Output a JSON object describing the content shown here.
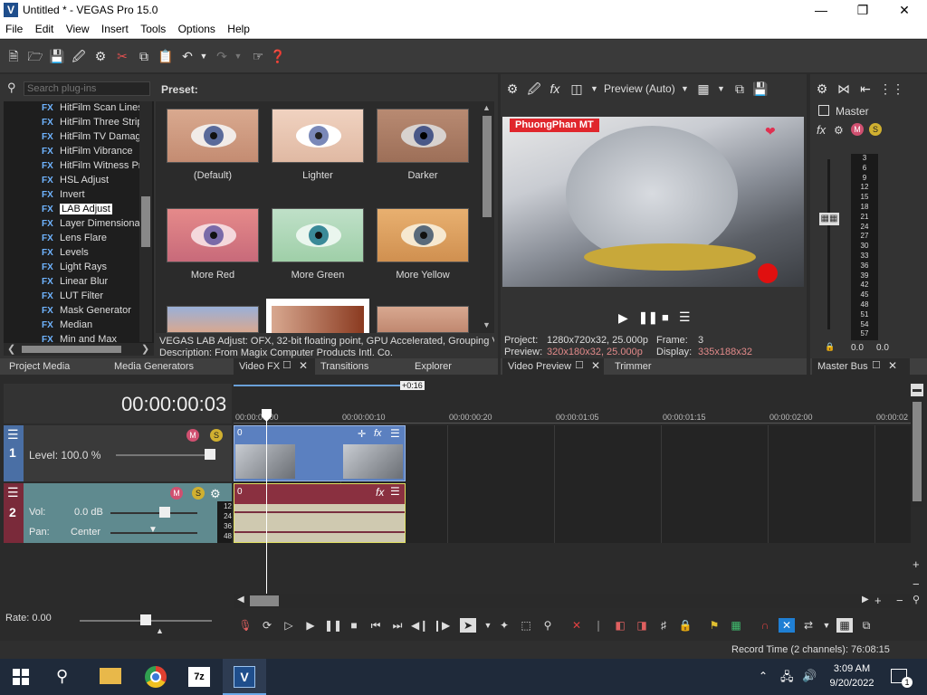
{
  "window": {
    "app_icon": "V",
    "title": "Untitled * - VEGAS Pro 15.0"
  },
  "menu": [
    "File",
    "Edit",
    "View",
    "Insert",
    "Tools",
    "Options",
    "Help"
  ],
  "plugins": {
    "search_placeholder": "Search plug-ins",
    "preset_label": "Preset:",
    "items": [
      "HitFilm Scan Lines",
      "HitFilm Three Strip",
      "HitFilm TV Damage",
      "HitFilm Vibrance",
      "HitFilm Witness Pr",
      "HSL Adjust",
      "Invert",
      "LAB Adjust",
      "Layer Dimensional",
      "Lens Flare",
      "Levels",
      "Light Rays",
      "Linear Blur",
      "LUT Filter",
      "Mask Generator",
      "Median",
      "Min and Max"
    ],
    "selected": "LAB Adjust",
    "presets": [
      "(Default)",
      "Lighter",
      "Darker",
      "More Red",
      "More Green",
      "More Yellow"
    ],
    "info_line1": "VEGAS LAB Adjust: OFX, 32-bit floating point, GPU Accelerated, Grouping VE",
    "info_line2": "Description: From Magix Computer Products Intl. Co."
  },
  "left_tabs": [
    "Project Media",
    "Media Generators",
    "Video FX",
    "Transitions",
    "Explorer"
  ],
  "preview": {
    "mode": "Preview (Auto)",
    "overlay_text": "PhuongPhan MT",
    "project_label": "Project:",
    "project_value": "1280x720x32, 25.000p",
    "preview_label": "Preview:",
    "preview_value": "320x180x32, 25.000p",
    "frame_label": "Frame:",
    "frame_value": "3",
    "display_label": "Display:",
    "display_value": "335x188x32",
    "tabs": [
      "Video Preview",
      "Trimmer"
    ]
  },
  "master": {
    "label": "Master",
    "scale": [
      "3",
      "6",
      "9",
      "12",
      "15",
      "18",
      "21",
      "24",
      "27",
      "30",
      "33",
      "36",
      "39",
      "42",
      "45",
      "48",
      "51",
      "54",
      "57"
    ],
    "readout_left": "0.0",
    "readout_right": "0.0",
    "tab": "Master Bus"
  },
  "timeline": {
    "timecode": "00:00:00:03",
    "marker": "+0:16",
    "ruler": [
      "00:00:00:00",
      "00:00:00:10",
      "00:00:00:20",
      "00:00:01:05",
      "00:00:01:15",
      "00:00:02:00",
      "00:00:02"
    ],
    "track1": {
      "number": "1",
      "level": "Level: 100.0 %",
      "clip_label": "0"
    },
    "track2": {
      "number": "2",
      "vol_label": "Vol:",
      "vol_value": "0.0 dB",
      "pan_label": "Pan:",
      "pan_value": "Center",
      "clip_label": "0",
      "db_scale": [
        "12",
        "24",
        "36",
        "48"
      ]
    },
    "rate": "Rate: 0.00"
  },
  "status": {
    "record_time": "Record Time (2 channels): 76:08:15"
  },
  "taskbar": {
    "time": "3:09 AM",
    "date": "9/20/2022",
    "notif_count": "1",
    "icon_7z": "7z",
    "icon_vegas": "V"
  },
  "colors": {
    "accent": "#1f7fd4",
    "video_track": "#4a6fa5",
    "audio_track": "#7a2a3a",
    "audio_clip": "#cfc9b0"
  }
}
